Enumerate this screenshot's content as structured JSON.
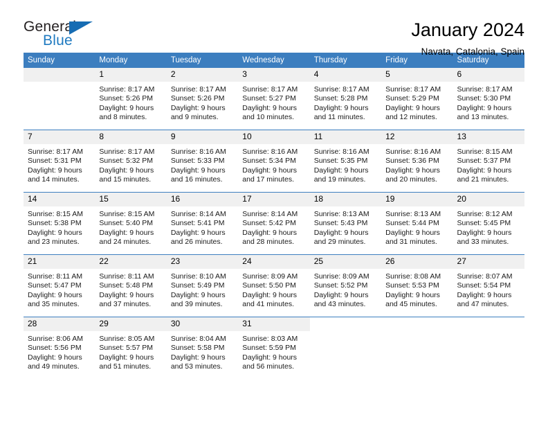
{
  "brand": {
    "name_top": "General",
    "name_bottom": "Blue",
    "accent_color": "#166cb3",
    "text_color": "#231f20"
  },
  "header": {
    "title": "January 2024",
    "location": "Navata, Catalonia, Spain"
  },
  "theme": {
    "header_bg": "#3c7ebf",
    "header_text": "#ffffff",
    "daynum_bg": "#f0f0f0",
    "row_divider": "#3c7ebf"
  },
  "weekdays": [
    "Sunday",
    "Monday",
    "Tuesday",
    "Wednesday",
    "Thursday",
    "Friday",
    "Saturday"
  ],
  "weeks": [
    [
      {
        "day": "",
        "sunrise": "",
        "sunset": "",
        "daylight1": "",
        "daylight2": "",
        "empty": true
      },
      {
        "day": "1",
        "sunrise": "Sunrise: 8:17 AM",
        "sunset": "Sunset: 5:26 PM",
        "daylight1": "Daylight: 9 hours",
        "daylight2": "and 8 minutes."
      },
      {
        "day": "2",
        "sunrise": "Sunrise: 8:17 AM",
        "sunset": "Sunset: 5:26 PM",
        "daylight1": "Daylight: 9 hours",
        "daylight2": "and 9 minutes."
      },
      {
        "day": "3",
        "sunrise": "Sunrise: 8:17 AM",
        "sunset": "Sunset: 5:27 PM",
        "daylight1": "Daylight: 9 hours",
        "daylight2": "and 10 minutes."
      },
      {
        "day": "4",
        "sunrise": "Sunrise: 8:17 AM",
        "sunset": "Sunset: 5:28 PM",
        "daylight1": "Daylight: 9 hours",
        "daylight2": "and 11 minutes."
      },
      {
        "day": "5",
        "sunrise": "Sunrise: 8:17 AM",
        "sunset": "Sunset: 5:29 PM",
        "daylight1": "Daylight: 9 hours",
        "daylight2": "and 12 minutes."
      },
      {
        "day": "6",
        "sunrise": "Sunrise: 8:17 AM",
        "sunset": "Sunset: 5:30 PM",
        "daylight1": "Daylight: 9 hours",
        "daylight2": "and 13 minutes."
      }
    ],
    [
      {
        "day": "7",
        "sunrise": "Sunrise: 8:17 AM",
        "sunset": "Sunset: 5:31 PM",
        "daylight1": "Daylight: 9 hours",
        "daylight2": "and 14 minutes."
      },
      {
        "day": "8",
        "sunrise": "Sunrise: 8:17 AM",
        "sunset": "Sunset: 5:32 PM",
        "daylight1": "Daylight: 9 hours",
        "daylight2": "and 15 minutes."
      },
      {
        "day": "9",
        "sunrise": "Sunrise: 8:16 AM",
        "sunset": "Sunset: 5:33 PM",
        "daylight1": "Daylight: 9 hours",
        "daylight2": "and 16 minutes."
      },
      {
        "day": "10",
        "sunrise": "Sunrise: 8:16 AM",
        "sunset": "Sunset: 5:34 PM",
        "daylight1": "Daylight: 9 hours",
        "daylight2": "and 17 minutes."
      },
      {
        "day": "11",
        "sunrise": "Sunrise: 8:16 AM",
        "sunset": "Sunset: 5:35 PM",
        "daylight1": "Daylight: 9 hours",
        "daylight2": "and 19 minutes."
      },
      {
        "day": "12",
        "sunrise": "Sunrise: 8:16 AM",
        "sunset": "Sunset: 5:36 PM",
        "daylight1": "Daylight: 9 hours",
        "daylight2": "and 20 minutes."
      },
      {
        "day": "13",
        "sunrise": "Sunrise: 8:15 AM",
        "sunset": "Sunset: 5:37 PM",
        "daylight1": "Daylight: 9 hours",
        "daylight2": "and 21 minutes."
      }
    ],
    [
      {
        "day": "14",
        "sunrise": "Sunrise: 8:15 AM",
        "sunset": "Sunset: 5:38 PM",
        "daylight1": "Daylight: 9 hours",
        "daylight2": "and 23 minutes."
      },
      {
        "day": "15",
        "sunrise": "Sunrise: 8:15 AM",
        "sunset": "Sunset: 5:40 PM",
        "daylight1": "Daylight: 9 hours",
        "daylight2": "and 24 minutes."
      },
      {
        "day": "16",
        "sunrise": "Sunrise: 8:14 AM",
        "sunset": "Sunset: 5:41 PM",
        "daylight1": "Daylight: 9 hours",
        "daylight2": "and 26 minutes."
      },
      {
        "day": "17",
        "sunrise": "Sunrise: 8:14 AM",
        "sunset": "Sunset: 5:42 PM",
        "daylight1": "Daylight: 9 hours",
        "daylight2": "and 28 minutes."
      },
      {
        "day": "18",
        "sunrise": "Sunrise: 8:13 AM",
        "sunset": "Sunset: 5:43 PM",
        "daylight1": "Daylight: 9 hours",
        "daylight2": "and 29 minutes."
      },
      {
        "day": "19",
        "sunrise": "Sunrise: 8:13 AM",
        "sunset": "Sunset: 5:44 PM",
        "daylight1": "Daylight: 9 hours",
        "daylight2": "and 31 minutes."
      },
      {
        "day": "20",
        "sunrise": "Sunrise: 8:12 AM",
        "sunset": "Sunset: 5:45 PM",
        "daylight1": "Daylight: 9 hours",
        "daylight2": "and 33 minutes."
      }
    ],
    [
      {
        "day": "21",
        "sunrise": "Sunrise: 8:11 AM",
        "sunset": "Sunset: 5:47 PM",
        "daylight1": "Daylight: 9 hours",
        "daylight2": "and 35 minutes."
      },
      {
        "day": "22",
        "sunrise": "Sunrise: 8:11 AM",
        "sunset": "Sunset: 5:48 PM",
        "daylight1": "Daylight: 9 hours",
        "daylight2": "and 37 minutes."
      },
      {
        "day": "23",
        "sunrise": "Sunrise: 8:10 AM",
        "sunset": "Sunset: 5:49 PM",
        "daylight1": "Daylight: 9 hours",
        "daylight2": "and 39 minutes."
      },
      {
        "day": "24",
        "sunrise": "Sunrise: 8:09 AM",
        "sunset": "Sunset: 5:50 PM",
        "daylight1": "Daylight: 9 hours",
        "daylight2": "and 41 minutes."
      },
      {
        "day": "25",
        "sunrise": "Sunrise: 8:09 AM",
        "sunset": "Sunset: 5:52 PM",
        "daylight1": "Daylight: 9 hours",
        "daylight2": "and 43 minutes."
      },
      {
        "day": "26",
        "sunrise": "Sunrise: 8:08 AM",
        "sunset": "Sunset: 5:53 PM",
        "daylight1": "Daylight: 9 hours",
        "daylight2": "and 45 minutes."
      },
      {
        "day": "27",
        "sunrise": "Sunrise: 8:07 AM",
        "sunset": "Sunset: 5:54 PM",
        "daylight1": "Daylight: 9 hours",
        "daylight2": "and 47 minutes."
      }
    ],
    [
      {
        "day": "28",
        "sunrise": "Sunrise: 8:06 AM",
        "sunset": "Sunset: 5:56 PM",
        "daylight1": "Daylight: 9 hours",
        "daylight2": "and 49 minutes."
      },
      {
        "day": "29",
        "sunrise": "Sunrise: 8:05 AM",
        "sunset": "Sunset: 5:57 PM",
        "daylight1": "Daylight: 9 hours",
        "daylight2": "and 51 minutes."
      },
      {
        "day": "30",
        "sunrise": "Sunrise: 8:04 AM",
        "sunset": "Sunset: 5:58 PM",
        "daylight1": "Daylight: 9 hours",
        "daylight2": "and 53 minutes."
      },
      {
        "day": "31",
        "sunrise": "Sunrise: 8:03 AM",
        "sunset": "Sunset: 5:59 PM",
        "daylight1": "Daylight: 9 hours",
        "daylight2": "and 56 minutes."
      },
      {
        "day": "",
        "sunrise": "",
        "sunset": "",
        "daylight1": "",
        "daylight2": "",
        "blank": true
      },
      {
        "day": "",
        "sunrise": "",
        "sunset": "",
        "daylight1": "",
        "daylight2": "",
        "blank": true
      },
      {
        "day": "",
        "sunrise": "",
        "sunset": "",
        "daylight1": "",
        "daylight2": "",
        "blank": true
      }
    ]
  ]
}
